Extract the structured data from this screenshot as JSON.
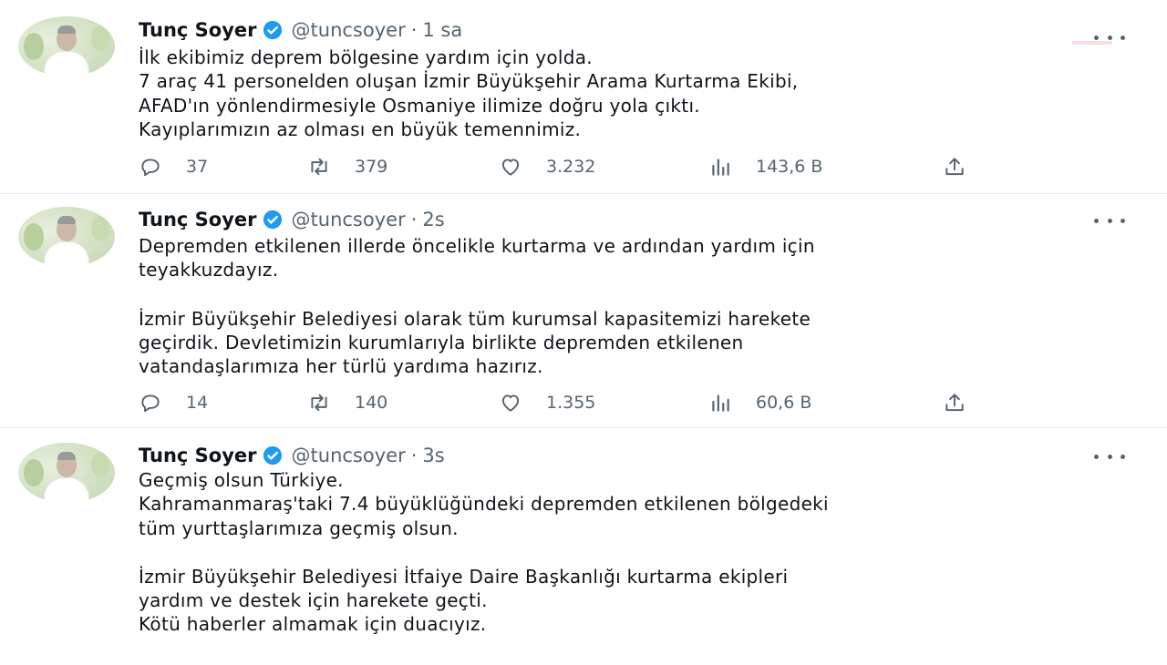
{
  "tweets": [
    {
      "author": "Tunç Soyer",
      "handle": "@tuncsoyer",
      "separator": "·",
      "time": "1 sa",
      "lines": [
        "İlk ekibimiz deprem bölgesine yardım için yolda.",
        "7 araç 41 personelden oluşan İzmir Büyükşehir Arama Kurtarma Ekibi,",
        "AFAD'ın yönlendirmesiyle Osmaniye ilimize doğru yola çıktı.",
        "Kayıplarımızın az olması en büyük temennimiz."
      ],
      "replies": "37",
      "retweets": "379",
      "likes": "3.232",
      "views": "143,6 B"
    },
    {
      "author": "Tunç Soyer",
      "handle": "@tuncsoyer",
      "separator": "·",
      "time": "2s",
      "lines": [
        "Depremden etkilenen illerde öncelikle kurtarma ve ardından yardım için",
        "teyakkuzdayız.",
        "",
        "İzmir Büyükşehir Belediyesi olarak tüm kurumsal kapasitemizi harekete",
        "geçirdik. Devletimizin kurumlarıyla birlikte depremden etkilenen",
        "vatandaşlarımıza her türlü yardıma hazırız."
      ],
      "replies": "14",
      "retweets": "140",
      "likes": "1.355",
      "views": "60,6 B"
    },
    {
      "author": "Tunç Soyer",
      "handle": "@tuncsoyer",
      "separator": "·",
      "time": "3s",
      "lines": [
        "Geçmiş olsun Türkiye.",
        "Kahramanmaraş'taki 7.4 büyüklüğündeki depremden etkilenen bölgedeki",
        "tüm yurttaşlarımıza geçmiş olsun.",
        "",
        "İzmir Büyükşehir Belediyesi İtfaiye Daire Başkanlığı kurtarma ekipleri",
        "yardım ve destek için harekete geçti.",
        "Kötü haberler almamak için duacıyız."
      ]
    }
  ],
  "icons": [
    "verified-badge-icon",
    "more-options-icon",
    "reply-icon",
    "retweet-icon",
    "like-icon",
    "views-icon",
    "share-icon"
  ],
  "colors": {
    "verified": "#1d9bf0",
    "muted": "#56646f",
    "text": "#0f1419",
    "divider": "#e6e9eb"
  }
}
